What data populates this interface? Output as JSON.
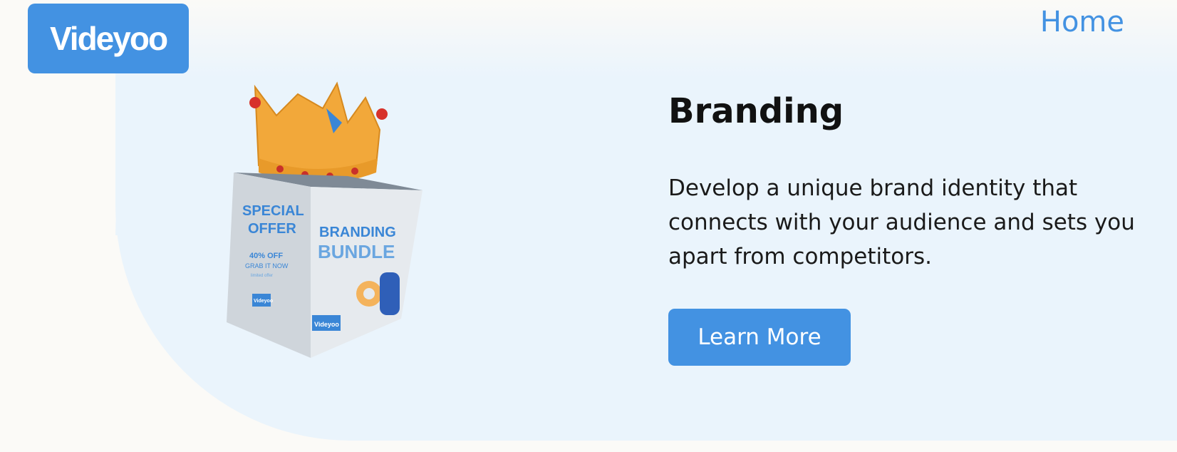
{
  "brand": {
    "logo_text": "Videyoo"
  },
  "nav": {
    "home_label": "Home"
  },
  "hero": {
    "title": "Branding",
    "description": "Develop a unique brand identity that connects with your audience and sets you apart from competitors.",
    "cta_label": "Learn More",
    "box_side_text": [
      "SPECIAL",
      "OFFER",
      "40% OFF",
      "GRAB IT NOW",
      "limited offer",
      "Videyoo"
    ],
    "box_front_text": [
      "BRANDING",
      "BUNDLE",
      "Videyoo"
    ]
  },
  "colors": {
    "accent": "#4392e2",
    "hero_bg": "#eaf4fc",
    "page_bg": "#fbfaf7",
    "crown": "#f2a83a"
  }
}
